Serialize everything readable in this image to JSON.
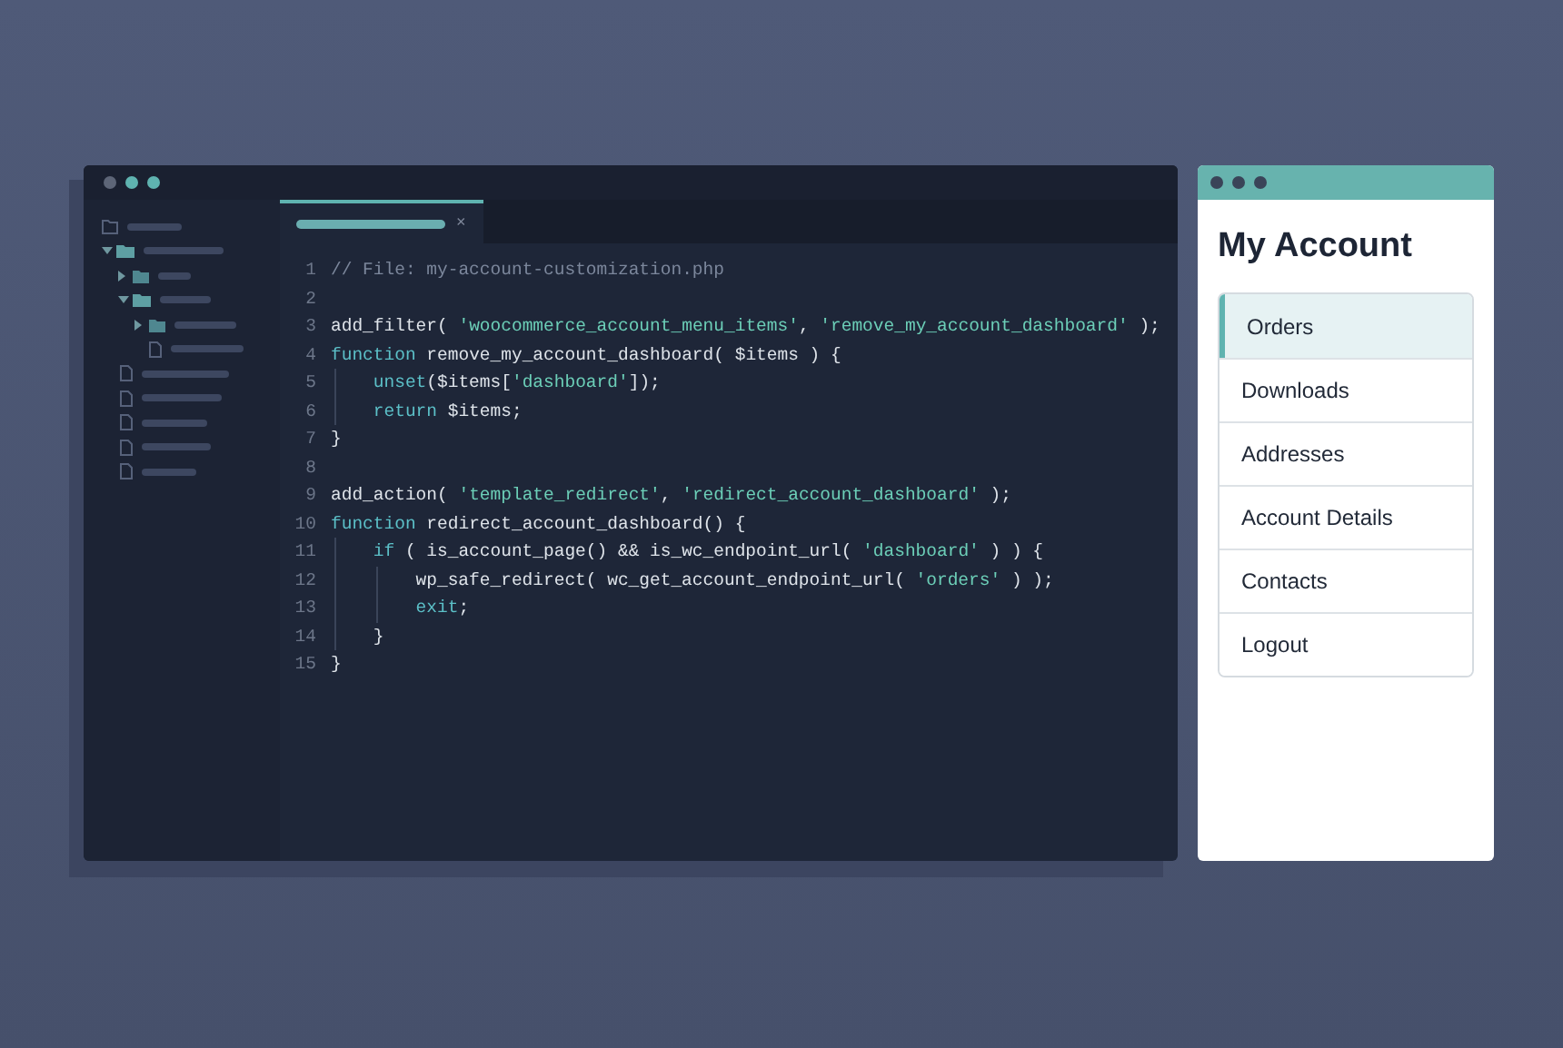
{
  "editor": {
    "tree": [
      {
        "kind": "root"
      },
      {
        "kind": "folder",
        "expanded": true,
        "children": [
          {
            "kind": "folder",
            "expanded": false
          },
          {
            "kind": "folder",
            "expanded": true,
            "children": [
              {
                "kind": "folder",
                "expanded": false
              },
              {
                "kind": "file"
              }
            ]
          }
        ]
      },
      {
        "kind": "file"
      },
      {
        "kind": "file"
      },
      {
        "kind": "file"
      },
      {
        "kind": "file"
      },
      {
        "kind": "file"
      }
    ],
    "tab": {
      "selected": true,
      "close": "×"
    },
    "lines": [
      {
        "number": "1",
        "tokens": [
          {
            "kind": "comment",
            "text": "// File: my-account-customization.php"
          }
        ]
      },
      {
        "number": "2"
      },
      {
        "number": "3",
        "tokens": [
          {
            "kind": "plain",
            "text": "add_filter( "
          },
          {
            "kind": "string",
            "text": "'woocommerce_account_menu_items'"
          },
          {
            "kind": "plain",
            "text": ", "
          },
          {
            "kind": "string",
            "text": "'remove_my_account_dashboard'"
          },
          {
            "kind": "plain",
            "text": " );"
          }
        ]
      },
      {
        "number": "4",
        "tokens": [
          {
            "kind": "keyword",
            "text": "function"
          },
          {
            "kind": "plain",
            "text": " remove_my_account_dashboard( $items ) {"
          }
        ],
        "children": [
          {
            "number": "5",
            "tokens": [
              {
                "kind": "keyword",
                "text": "unset"
              },
              {
                "kind": "plain",
                "text": "($items["
              },
              {
                "kind": "string",
                "text": "'dashboard'"
              },
              {
                "kind": "plain",
                "text": "]);"
              }
            ]
          },
          {
            "number": "6",
            "tokens": [
              {
                "kind": "keyword",
                "text": "return"
              },
              {
                "kind": "plain",
                "text": " $items;"
              }
            ]
          }
        ]
      },
      {
        "number": "7",
        "tokens": [
          {
            "kind": "plain",
            "text": "}"
          }
        ]
      },
      {
        "number": "8"
      },
      {
        "number": "9",
        "tokens": [
          {
            "kind": "plain",
            "text": "add_action( "
          },
          {
            "kind": "string",
            "text": "'template_redirect'"
          },
          {
            "kind": "plain",
            "text": ", "
          },
          {
            "kind": "string",
            "text": "'redirect_account_dashboard'"
          },
          {
            "kind": "plain",
            "text": " );"
          }
        ]
      },
      {
        "number": "10",
        "tokens": [
          {
            "kind": "keyword",
            "text": "function"
          },
          {
            "kind": "plain",
            "text": " redirect_account_dashboard() {"
          }
        ],
        "children": [
          {
            "number": "11",
            "tokens": [
              {
                "kind": "keyword",
                "text": "if"
              },
              {
                "kind": "plain",
                "text": " ( is_account_page() && is_wc_endpoint_url( "
              },
              {
                "kind": "string",
                "text": "'dashboard'"
              },
              {
                "kind": "plain",
                "text": " ) ) {"
              }
            ],
            "children": [
              {
                "number": "12",
                "tokens": [
                  {
                    "kind": "plain",
                    "text": "wp_safe_redirect( wc_get_account_endpoint_url( "
                  },
                  {
                    "kind": "string",
                    "text": "'orders'"
                  },
                  {
                    "kind": "plain",
                    "text": " ) );"
                  }
                ]
              },
              {
                "number": "13",
                "tokens": [
                  {
                    "kind": "keyword",
                    "text": "exit"
                  },
                  {
                    "kind": "plain",
                    "text": ";"
                  }
                ]
              }
            ]
          },
          {
            "number": "14",
            "tokens": [
              {
                "kind": "plain",
                "text": "}"
              }
            ]
          }
        ]
      },
      {
        "number": "15",
        "tokens": [
          {
            "kind": "plain",
            "text": "}"
          }
        ]
      }
    ]
  },
  "browser": {
    "title": "My Account",
    "menu": [
      {
        "label": "Orders",
        "selected": true
      },
      {
        "label": "Downloads",
        "selected": false
      },
      {
        "label": "Addresses",
        "selected": false
      },
      {
        "label": "Account Details",
        "selected": false
      },
      {
        "label": "Contacts",
        "selected": false
      },
      {
        "label": "Logout",
        "selected": false
      }
    ]
  }
}
